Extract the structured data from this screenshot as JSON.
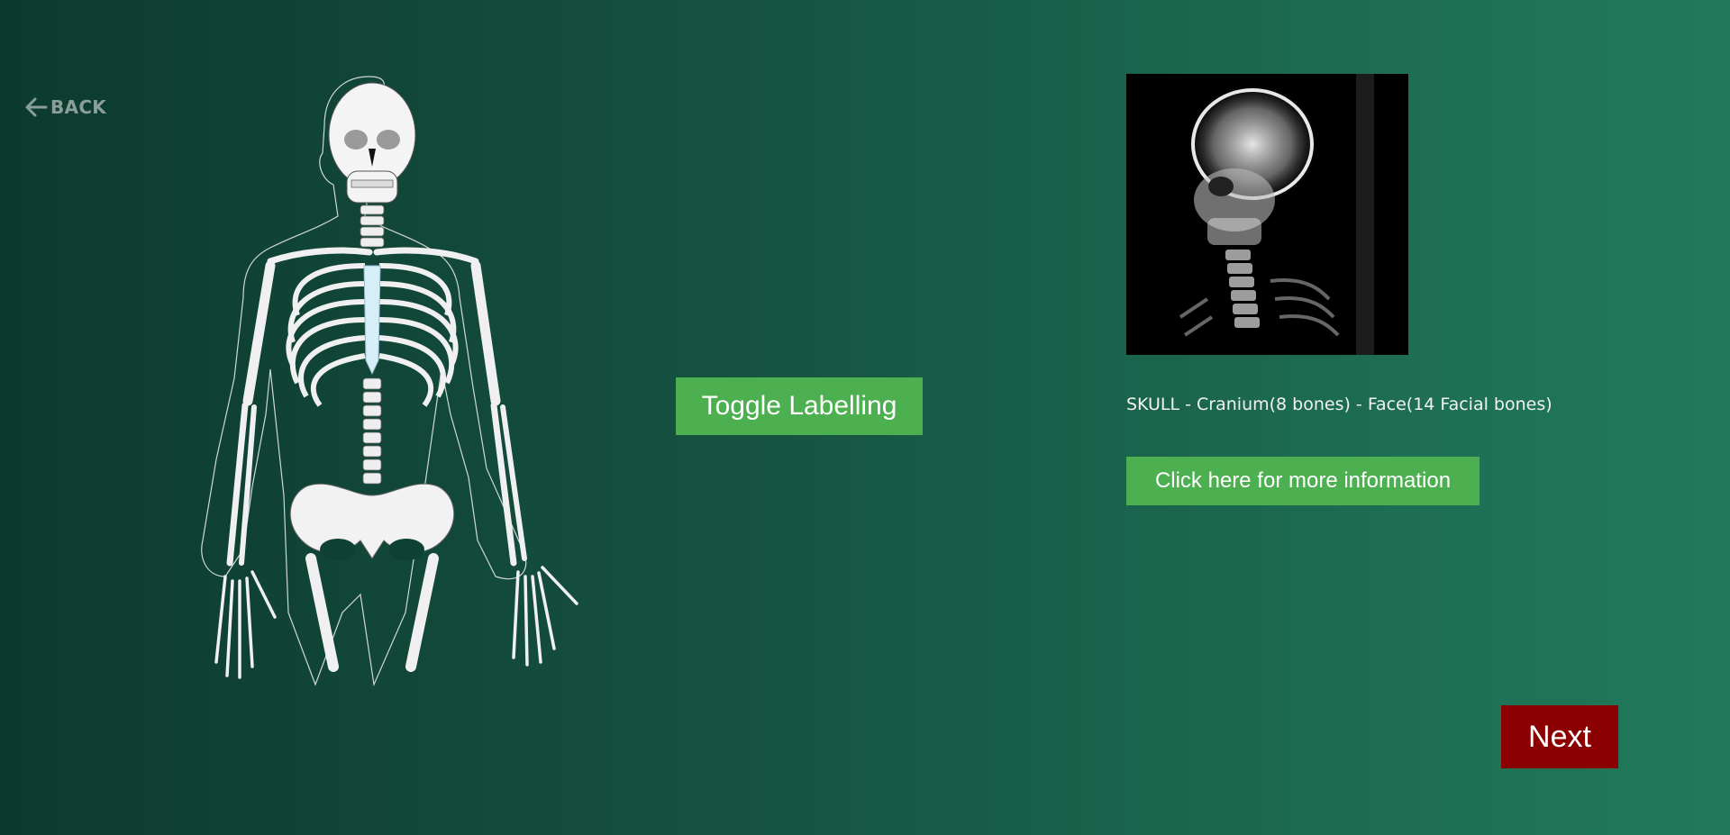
{
  "nav": {
    "back_label": "BACK",
    "back_icon": "arrow-left-icon"
  },
  "illustration": {
    "subject": "skeleton-upper-body"
  },
  "toggle": {
    "label": "Toggle Labelling"
  },
  "detail": {
    "xray_subject": "skull-xray",
    "caption": "SKULL - Cranium(8 bones) - Face(14 Facial bones)",
    "info_label": "Click here for more information"
  },
  "footer": {
    "next_label": "Next"
  },
  "colors": {
    "background_start": "#0c3a2e",
    "background_end": "#217a5c",
    "button_green": "#4caf50",
    "next_red": "#8b0000",
    "back_gray": "#8a9f98"
  }
}
